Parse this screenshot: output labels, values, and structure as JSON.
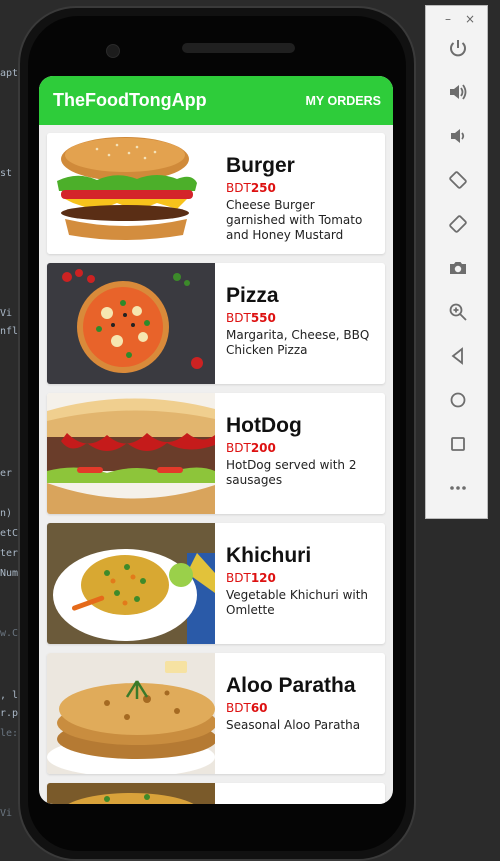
{
  "app": {
    "title": "TheFoodTongApp",
    "orders_label": "MY ORDERS",
    "accent_color": "#2ecc3a",
    "price_color": "#dd1111"
  },
  "foods": [
    {
      "name": "Burger",
      "currency": "BDT",
      "price": "250",
      "desc": "Cheese Burger garnished with Tomato and Honey Mustard"
    },
    {
      "name": "Pizza",
      "currency": "BDT",
      "price": "550",
      "desc": "Margarita, Cheese, BBQ Chicken Pizza"
    },
    {
      "name": "HotDog",
      "currency": "BDT",
      "price": "200",
      "desc": "HotDog served with 2 sausages"
    },
    {
      "name": "Khichuri",
      "currency": "BDT",
      "price": "120",
      "desc": "Vegetable Khichuri with Omlette"
    },
    {
      "name": "Aloo Paratha",
      "currency": "BDT",
      "price": "60",
      "desc": "Seasonal Aloo Paratha"
    }
  ],
  "emulator_toolbar": {
    "minimize": "–",
    "close": "×",
    "items": [
      "power-icon",
      "volume-up-icon",
      "volume-down-icon",
      "rotate-left-icon",
      "rotate-right-icon",
      "camera-icon",
      "zoom-icon",
      "back-icon",
      "home-icon",
      "overview-icon",
      "more-icon"
    ]
  },
  "ide_fragments": [
    "apt",
    "st",
    "Vi",
    "nfl",
    "er",
    "n)",
    "etC",
    "ter",
    "Num",
    "w.C",
    ", l",
    "r.p",
    "le:",
    "Vi"
  ]
}
